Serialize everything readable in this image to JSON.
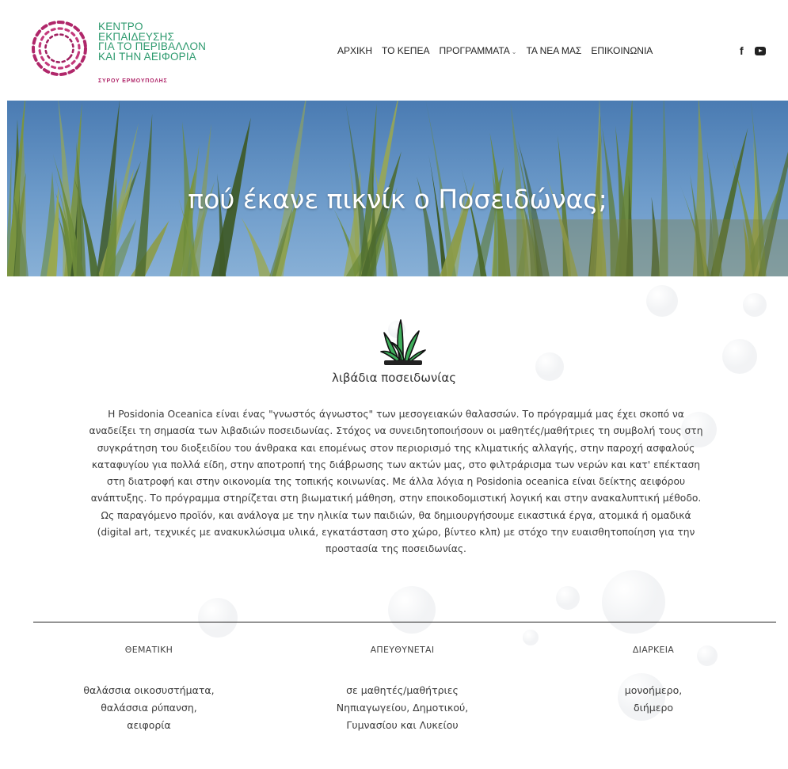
{
  "logo": {
    "lines": [
      "ΚΕΝΤΡΟ",
      "ΕΚΠΑΙΔΕΥΣΗΣ",
      "ΓΙΑ ΤΟ ΠΕΡΙΒΑΛΛΟΝ",
      "ΚΑΙ ΤΗΝ ΑΕΙΦΟΡΙΑ"
    ],
    "sub": "ΣΥΡΟΥ ΕΡΜΟΥΠΟΛΗΣ",
    "icon": "logo-dotted-ring",
    "colors": {
      "green": "#2d9a6e",
      "magenta": "#b0276a"
    }
  },
  "nav": {
    "items": [
      "ΑΡΧΙΚΗ",
      "ΤΟ ΚΕΠΕΑ",
      "ΠΡΟΓΡΑΜΜΑΤΑ",
      "ΤΑ ΝΕΑ ΜΑΣ",
      "ΕΠΙΚΟΙΝΩΝΙΑ"
    ],
    "facebook": "f",
    "youtube_icon": "youtube-icon"
  },
  "hero": {
    "title": "πού έκανε πικνίκ ο Ποσειδώνας;"
  },
  "content": {
    "icon": "seagrass-icon",
    "subtitle": "λιβάδια ποσειδωνίας",
    "description_lines": [
      "Η Posidonia Oceanica είναι ένας \"γνωστός άγνωστος\" των μεσογειακών θαλασσών. Το πρόγραμμά μας έχει σκοπό να",
      "αναδείξει τη σημασία των λιβαδιών ποσειδωνίας. Στόχος να συνειδητοποιήσουν οι μαθητές/μαθήτριες τη συμβολή τους στη",
      "συγκράτηση του διοξειδίου του άνθρακα και επομένως στον περιορισμό της κλιματικής αλλαγής, στην παροχή ασφαλούς",
      "καταφυγίου για πολλά είδη, στην αποτροπή της διάβρωσης των ακτών μας, στο φιλτράρισμα των νερών και κατ' επέκταση",
      "στη διατροφή και στην οικονομία της τοπικής κοινωνίας. Με άλλα λόγια η Posidonia oceanica είναι δείκτης αειφόρου",
      "ανάπτυξης. Το πρόγραμμα στηρίζεται στη βιωματική μάθηση, στην εποικοδομιστική λογική και στην ανακαλυπτική μέθοδο.",
      "Ως παραγόμενο προϊόν, και ανάλογα με την ηλικία των παιδιών, θα δημιουργήσουμε εικαστικά έργα, ατομικά ή ομαδικά",
      "(digital art, τεχνικές  με ανακυκλώσιμα υλικά,  εγκατάσταση στο χώρο, βίντεο κλπ) με στόχο την ευαισθητοποίηση για την",
      "προστασία της ποσειδωνίας."
    ]
  },
  "info": {
    "columns": [
      {
        "heading": "ΘΕΜΑΤΙΚΗ",
        "lines": [
          "θαλάσσια οικοσυστήματα,",
          "θαλάσσια ρύπανση,",
          "αειφορία"
        ]
      },
      {
        "heading": "ΑΠΕΥΘΥΝΕΤΑΙ",
        "lines": [
          "σε μαθητές/μαθήτριες",
          "Νηπιαγωγείου, Δημοτικού,",
          "Γυμνασίου και Λυκείου"
        ]
      },
      {
        "heading": "ΔΙΑΡΚΕΙΑ",
        "lines": [
          "μονοήμερο,",
          "διήμερο"
        ]
      }
    ]
  }
}
